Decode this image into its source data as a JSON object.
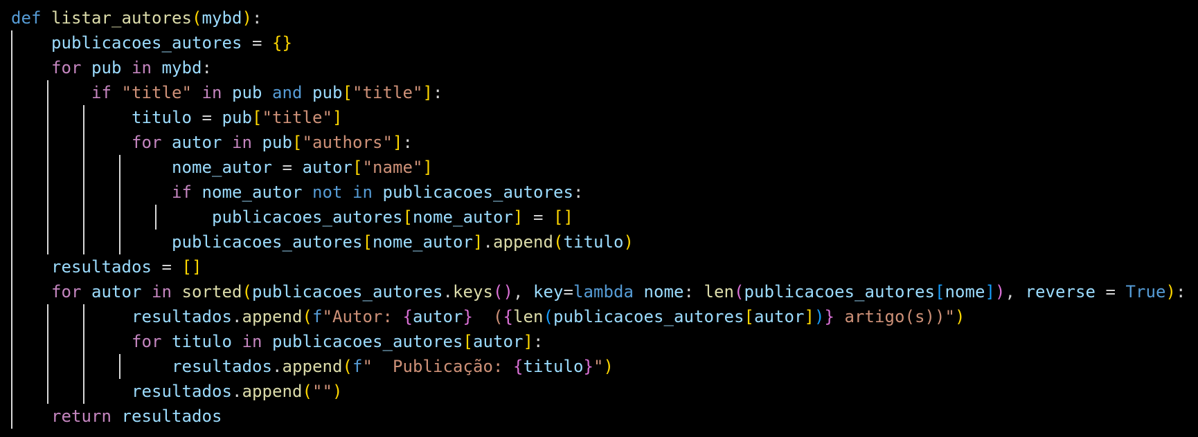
{
  "editor": {
    "language": "python",
    "colors": {
      "background": "#000000",
      "keyword": "#569cd6",
      "control": "#c586c0",
      "function": "#dcdcaa",
      "variable": "#9cdcfe",
      "string": "#ce9178",
      "bracket_level1": "#ffd700",
      "bracket_level2": "#da70d6",
      "bracket_level3": "#179fff",
      "indent_guide": "#d9d9d9"
    },
    "lines": [
      {
        "tokens": [
          [
            "kw",
            "def"
          ],
          [
            "plain",
            " "
          ],
          [
            "fn",
            "listar_autores"
          ],
          [
            "br1",
            "("
          ],
          [
            "var",
            "mybd"
          ],
          [
            "br1",
            ")"
          ],
          [
            "plain",
            ":"
          ]
        ]
      },
      {
        "tokens": [
          [
            "plain",
            "    "
          ],
          [
            "var",
            "publicacoes_autores"
          ],
          [
            "plain",
            " = "
          ],
          [
            "br1",
            "{}"
          ]
        ]
      },
      {
        "tokens": [
          [
            "plain",
            "    "
          ],
          [
            "ctrl",
            "for"
          ],
          [
            "plain",
            " "
          ],
          [
            "var",
            "pub"
          ],
          [
            "plain",
            " "
          ],
          [
            "ctrl",
            "in"
          ],
          [
            "plain",
            " "
          ],
          [
            "var",
            "mybd"
          ],
          [
            "plain",
            ":"
          ]
        ]
      },
      {
        "tokens": [
          [
            "plain",
            "        "
          ],
          [
            "ctrl",
            "if"
          ],
          [
            "plain",
            " "
          ],
          [
            "str",
            "\"title\""
          ],
          [
            "plain",
            " "
          ],
          [
            "ctrl",
            "in"
          ],
          [
            "plain",
            " "
          ],
          [
            "var",
            "pub"
          ],
          [
            "plain",
            " "
          ],
          [
            "kw",
            "and"
          ],
          [
            "plain",
            " "
          ],
          [
            "var",
            "pub"
          ],
          [
            "br1",
            "["
          ],
          [
            "str",
            "\"title\""
          ],
          [
            "br1",
            "]"
          ],
          [
            "plain",
            ":"
          ]
        ]
      },
      {
        "tokens": [
          [
            "plain",
            "            "
          ],
          [
            "var",
            "titulo"
          ],
          [
            "plain",
            " = "
          ],
          [
            "var",
            "pub"
          ],
          [
            "br1",
            "["
          ],
          [
            "str",
            "\"title\""
          ],
          [
            "br1",
            "]"
          ]
        ]
      },
      {
        "tokens": [
          [
            "plain",
            "            "
          ],
          [
            "ctrl",
            "for"
          ],
          [
            "plain",
            " "
          ],
          [
            "var",
            "autor"
          ],
          [
            "plain",
            " "
          ],
          [
            "ctrl",
            "in"
          ],
          [
            "plain",
            " "
          ],
          [
            "var",
            "pub"
          ],
          [
            "br1",
            "["
          ],
          [
            "str",
            "\"authors\""
          ],
          [
            "br1",
            "]"
          ],
          [
            "plain",
            ":"
          ]
        ]
      },
      {
        "tokens": [
          [
            "plain",
            "                "
          ],
          [
            "var",
            "nome_autor"
          ],
          [
            "plain",
            " = "
          ],
          [
            "var",
            "autor"
          ],
          [
            "br1",
            "["
          ],
          [
            "str",
            "\"name\""
          ],
          [
            "br1",
            "]"
          ]
        ]
      },
      {
        "tokens": [
          [
            "plain",
            "                "
          ],
          [
            "ctrl",
            "if"
          ],
          [
            "plain",
            " "
          ],
          [
            "var",
            "nome_autor"
          ],
          [
            "plain",
            " "
          ],
          [
            "kw",
            "not"
          ],
          [
            "plain",
            " "
          ],
          [
            "kw",
            "in"
          ],
          [
            "plain",
            " "
          ],
          [
            "var",
            "publicacoes_autores"
          ],
          [
            "plain",
            ":"
          ]
        ]
      },
      {
        "tokens": [
          [
            "plain",
            "                    "
          ],
          [
            "var",
            "publicacoes_autores"
          ],
          [
            "br1",
            "["
          ],
          [
            "var",
            "nome_autor"
          ],
          [
            "br1",
            "]"
          ],
          [
            "plain",
            " = "
          ],
          [
            "br1",
            "[]"
          ]
        ]
      },
      {
        "tokens": [
          [
            "plain",
            "                "
          ],
          [
            "var",
            "publicacoes_autores"
          ],
          [
            "br1",
            "["
          ],
          [
            "var",
            "nome_autor"
          ],
          [
            "br1",
            "]"
          ],
          [
            "plain",
            "."
          ],
          [
            "fn",
            "append"
          ],
          [
            "br1",
            "("
          ],
          [
            "var",
            "titulo"
          ],
          [
            "br1",
            ")"
          ]
        ]
      },
      {
        "tokens": [
          [
            "plain",
            "    "
          ],
          [
            "var",
            "resultados"
          ],
          [
            "plain",
            " = "
          ],
          [
            "br1",
            "[]"
          ]
        ]
      },
      {
        "tokens": [
          [
            "plain",
            "    "
          ],
          [
            "ctrl",
            "for"
          ],
          [
            "plain",
            " "
          ],
          [
            "var",
            "autor"
          ],
          [
            "plain",
            " "
          ],
          [
            "ctrl",
            "in"
          ],
          [
            "plain",
            " "
          ],
          [
            "fn",
            "sorted"
          ],
          [
            "br1",
            "("
          ],
          [
            "var",
            "publicacoes_autores"
          ],
          [
            "plain",
            "."
          ],
          [
            "fn",
            "keys"
          ],
          [
            "br2",
            "()"
          ],
          [
            "plain",
            ", "
          ],
          [
            "var",
            "key"
          ],
          [
            "plain",
            "="
          ],
          [
            "kw",
            "lambda"
          ],
          [
            "plain",
            " "
          ],
          [
            "var",
            "nome"
          ],
          [
            "plain",
            ": "
          ],
          [
            "fn",
            "len"
          ],
          [
            "br2",
            "("
          ],
          [
            "var",
            "publicacoes_autores"
          ],
          [
            "br3",
            "["
          ],
          [
            "var",
            "nome"
          ],
          [
            "br3",
            "]"
          ],
          [
            "br2",
            ")"
          ],
          [
            "plain",
            ", "
          ],
          [
            "var",
            "reverse"
          ],
          [
            "plain",
            " = "
          ],
          [
            "const",
            "True"
          ],
          [
            "br1",
            ")"
          ],
          [
            "plain",
            ":"
          ]
        ]
      },
      {
        "tokens": [
          [
            "plain",
            "            "
          ],
          [
            "var",
            "resultados"
          ],
          [
            "plain",
            "."
          ],
          [
            "fn",
            "append"
          ],
          [
            "br1",
            "("
          ],
          [
            "kw",
            "f"
          ],
          [
            "str",
            "\"Autor: "
          ],
          [
            "br2",
            "{"
          ],
          [
            "var",
            "autor"
          ],
          [
            "br2",
            "}"
          ],
          [
            "str",
            "  ("
          ],
          [
            "br2",
            "{"
          ],
          [
            "fn",
            "len"
          ],
          [
            "br3",
            "("
          ],
          [
            "var",
            "publicacoes_autores"
          ],
          [
            "br1",
            "["
          ],
          [
            "var",
            "autor"
          ],
          [
            "br1",
            "]"
          ],
          [
            "br3",
            ")"
          ],
          [
            "br2",
            "}"
          ],
          [
            "str",
            " artigo(s))\""
          ],
          [
            "br1",
            ")"
          ]
        ]
      },
      {
        "tokens": [
          [
            "plain",
            "            "
          ],
          [
            "ctrl",
            "for"
          ],
          [
            "plain",
            " "
          ],
          [
            "var",
            "titulo"
          ],
          [
            "plain",
            " "
          ],
          [
            "ctrl",
            "in"
          ],
          [
            "plain",
            " "
          ],
          [
            "var",
            "publicacoes_autores"
          ],
          [
            "br1",
            "["
          ],
          [
            "var",
            "autor"
          ],
          [
            "br1",
            "]"
          ],
          [
            "plain",
            ":"
          ]
        ]
      },
      {
        "tokens": [
          [
            "plain",
            "                "
          ],
          [
            "var",
            "resultados"
          ],
          [
            "plain",
            "."
          ],
          [
            "fn",
            "append"
          ],
          [
            "br1",
            "("
          ],
          [
            "kw",
            "f"
          ],
          [
            "str",
            "\"  Publicação: "
          ],
          [
            "br2",
            "{"
          ],
          [
            "var",
            "titulo"
          ],
          [
            "br2",
            "}"
          ],
          [
            "str",
            "\""
          ],
          [
            "br1",
            ")"
          ]
        ]
      },
      {
        "tokens": [
          [
            "plain",
            "            "
          ],
          [
            "var",
            "resultados"
          ],
          [
            "plain",
            "."
          ],
          [
            "fn",
            "append"
          ],
          [
            "br1",
            "("
          ],
          [
            "str",
            "\"\""
          ],
          [
            "br1",
            ")"
          ]
        ]
      },
      {
        "tokens": [
          [
            "plain",
            "    "
          ],
          [
            "ctrl",
            "return"
          ],
          [
            "plain",
            " "
          ],
          [
            "var",
            "resultados"
          ]
        ]
      }
    ]
  }
}
